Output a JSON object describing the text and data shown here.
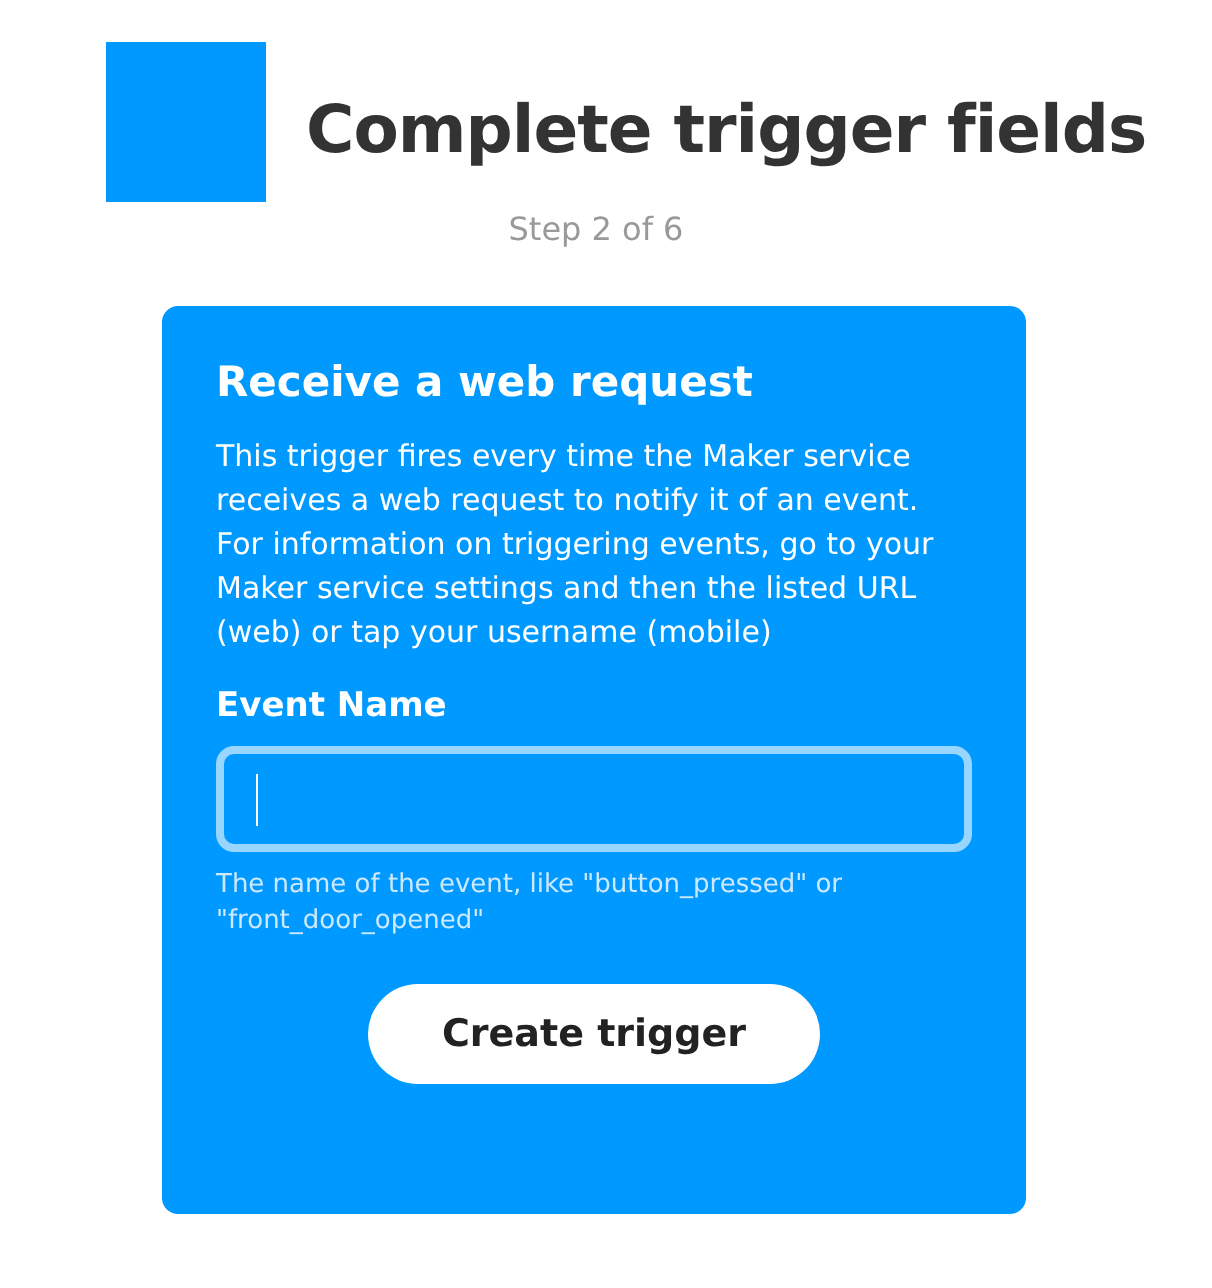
{
  "header": {
    "title": "Complete trigger fields",
    "step": "Step 2 of 6"
  },
  "card": {
    "title": "Receive a web request",
    "description": "This trigger fires every time the Maker service receives a web request to notify it of an event. For information on triggering events, go to your Maker service settings and then the listed URL (web) or tap your username (mobile)",
    "field": {
      "label": "Event Name",
      "focused": true,
      "help": "The name of the event, like \"button_pressed\" or \"front_door_opened\""
    },
    "button": "Create trigger"
  }
}
